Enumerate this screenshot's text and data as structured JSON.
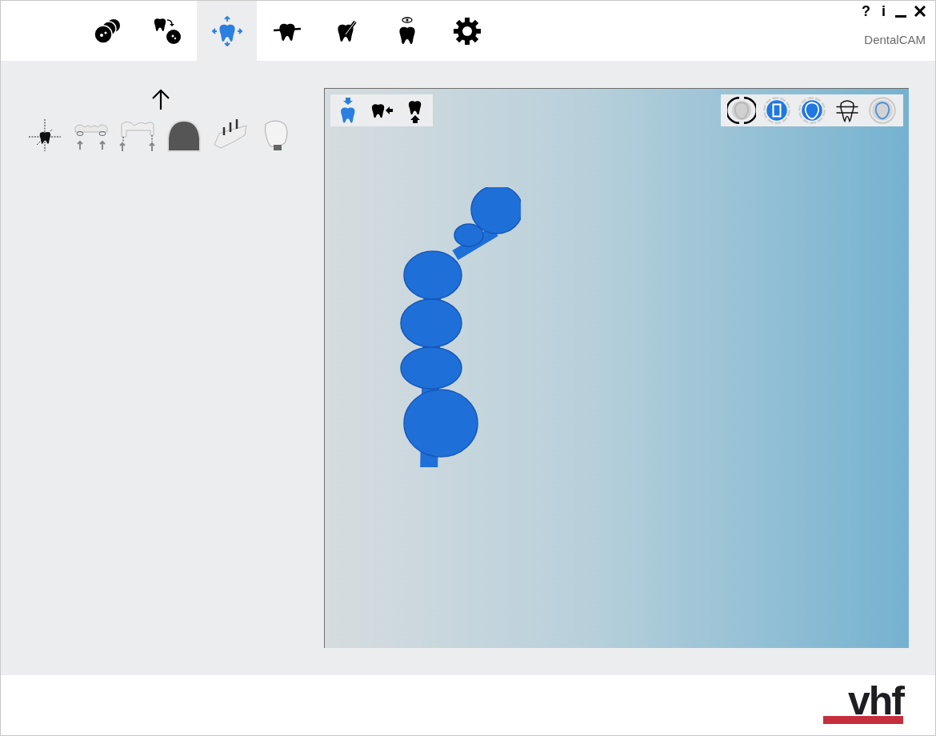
{
  "window": {
    "help": "?",
    "info": "i",
    "app_name": "DentalCAM"
  },
  "nav_tabs": [
    {
      "kind": "scan",
      "selected": false
    },
    {
      "kind": "tooth-transfer",
      "selected": false
    },
    {
      "kind": "move",
      "selected": true
    },
    {
      "kind": "tooth-bar",
      "selected": false
    },
    {
      "kind": "tooth-tool",
      "selected": false
    },
    {
      "kind": "tooth-eye",
      "selected": false
    },
    {
      "kind": "settings",
      "selected": false
    }
  ],
  "tool_panel": {
    "thumbnails": [
      {
        "kind": "axes"
      },
      {
        "kind": "bridge-rings"
      },
      {
        "kind": "bridge-pins"
      },
      {
        "kind": "jaw"
      },
      {
        "kind": "bridge-posts"
      },
      {
        "kind": "crown"
      }
    ]
  },
  "viewport": {
    "view_tools": [
      {
        "kind": "down",
        "selected": true
      },
      {
        "kind": "side",
        "selected": false
      },
      {
        "kind": "up",
        "selected": false
      }
    ],
    "display_modes": [
      {
        "kind": "ring"
      },
      {
        "kind": "filled-square"
      },
      {
        "kind": "filled-tooth"
      },
      {
        "kind": "lines"
      },
      {
        "kind": "muted"
      }
    ]
  },
  "footer": {
    "logo": "vhf"
  }
}
